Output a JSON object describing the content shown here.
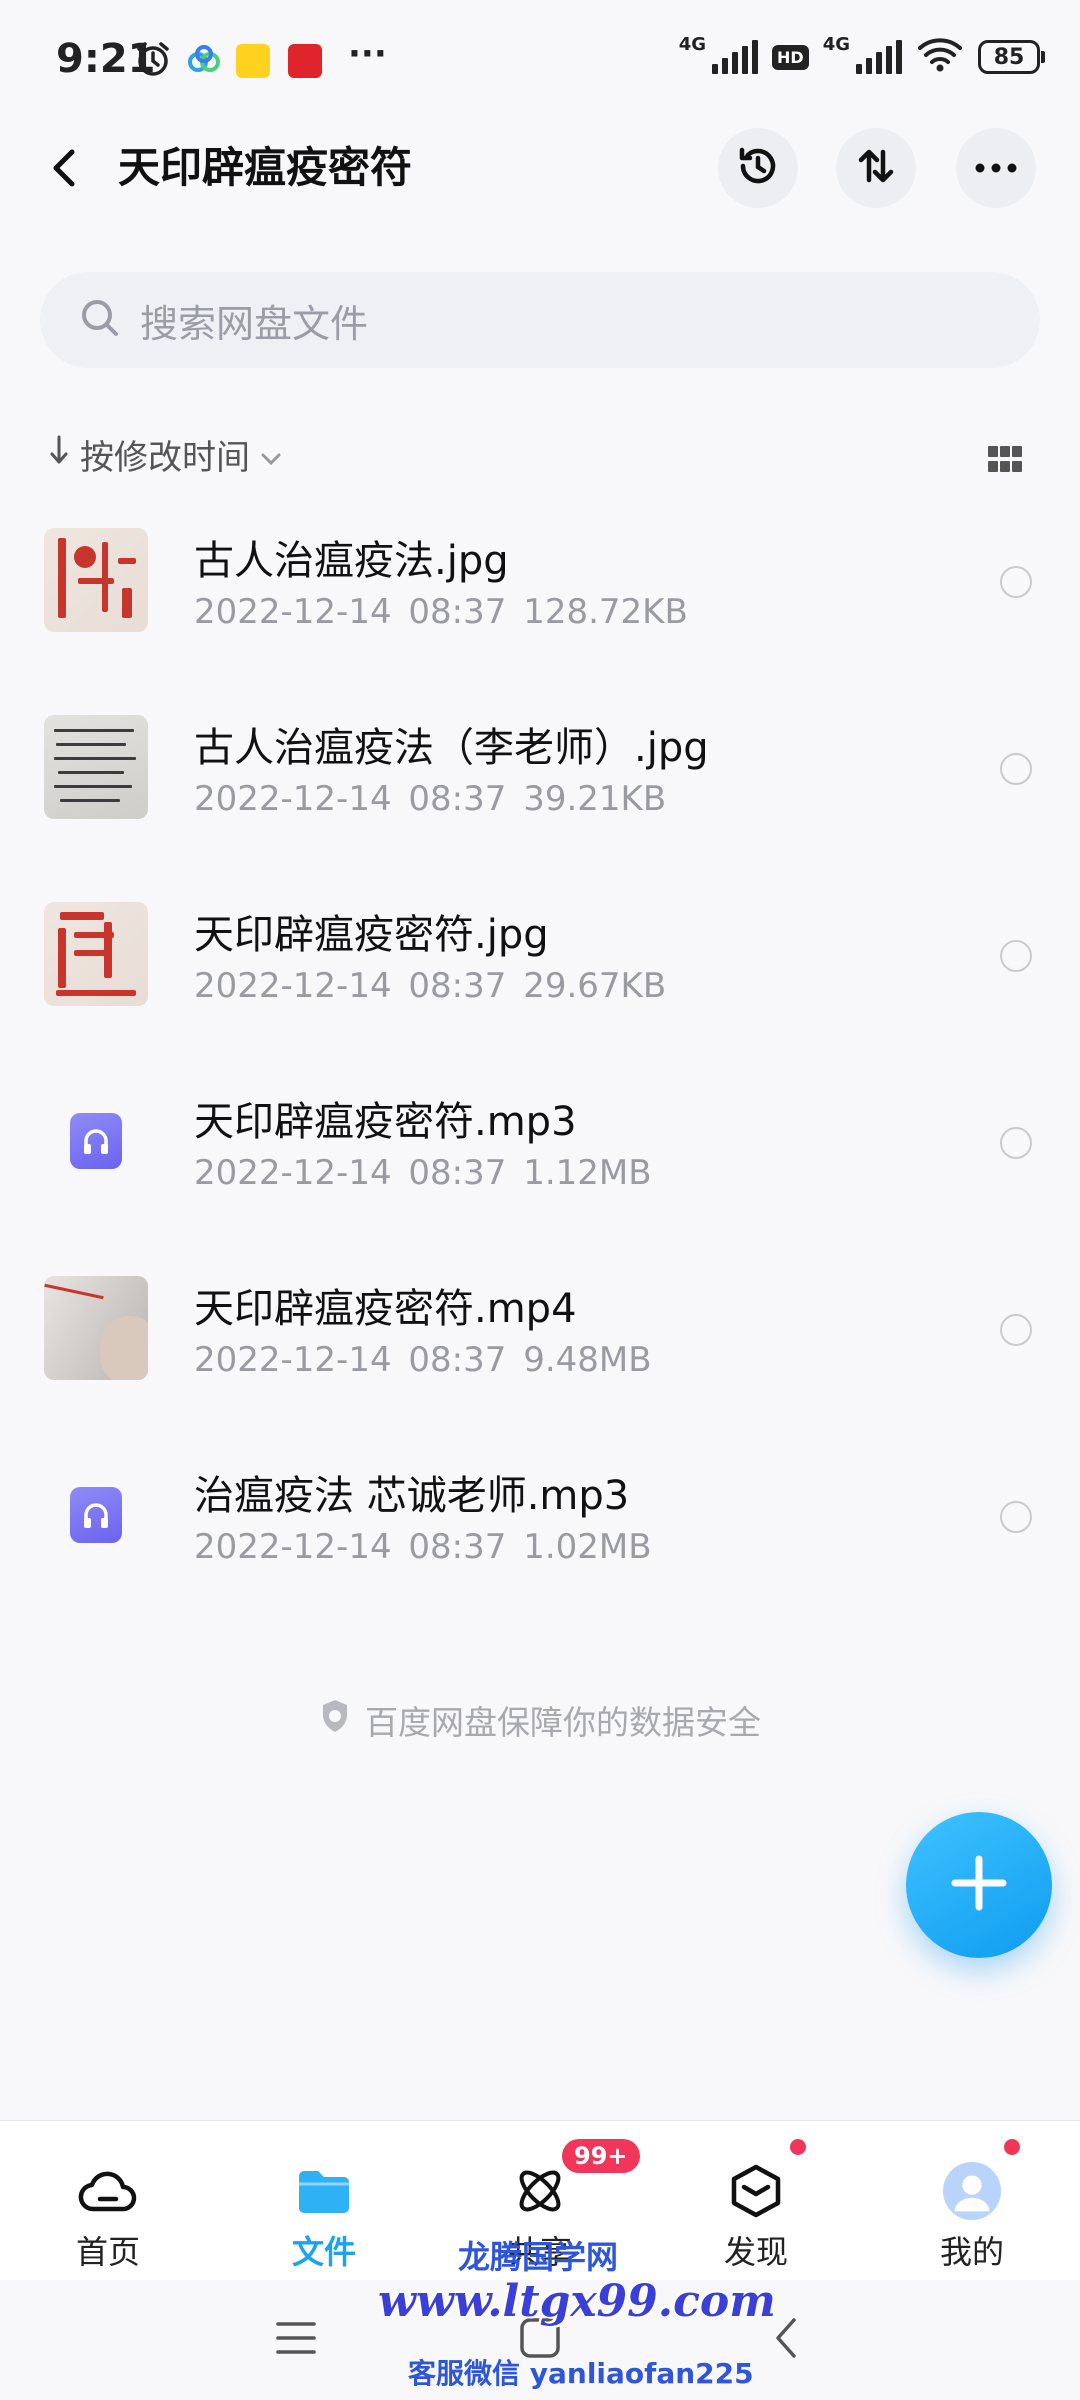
{
  "status_bar": {
    "time": "9:21",
    "network_1": "4G",
    "hd": "HD",
    "network_2": "4G",
    "battery": "85"
  },
  "header": {
    "title": "天印辟瘟疫密符",
    "icons": [
      "back-icon",
      "history-icon",
      "sort-transfer-icon",
      "more-icon"
    ]
  },
  "search": {
    "placeholder": "搜索网盘文件"
  },
  "sort": {
    "label": "按修改时间"
  },
  "files": [
    {
      "name": "古人治瘟疫法.jpg",
      "meta": "2022-12-14  08:37  128.72KB",
      "kind": "image"
    },
    {
      "name": "古人治瘟疫法（李老师）.jpg",
      "meta": "2022-12-14  08:37  39.21KB",
      "kind": "image"
    },
    {
      "name": "天印辟瘟疫密符.jpg",
      "meta": "2022-12-14  08:37  29.67KB",
      "kind": "image"
    },
    {
      "name": "天印辟瘟疫密符.mp3",
      "meta": "2022-12-14  08:37  1.12MB",
      "kind": "audio"
    },
    {
      "name": "天印辟瘟疫密符.mp4",
      "meta": "2022-12-14  08:37  9.48MB",
      "kind": "video"
    },
    {
      "name": "治瘟疫法 芯诚老师.mp3",
      "meta": "2022-12-14  08:37  1.02MB",
      "kind": "audio"
    }
  ],
  "footer_note": "百度网盘保障你的数据安全",
  "nav": {
    "tabs": [
      {
        "label": "首页",
        "icon": "cloud-icon"
      },
      {
        "label": "文件",
        "icon": "folder-icon",
        "active": true
      },
      {
        "label": "共享",
        "icon": "atom-icon",
        "badge": "99+"
      },
      {
        "label": "发现",
        "icon": "cube-icon"
      },
      {
        "label": "我的",
        "icon": "avatar-icon"
      }
    ]
  },
  "watermark": {
    "line1": "龙腾国学网",
    "line2": "www.ltgx99.com",
    "line3": "客服微信 yanliaofan225"
  },
  "colors": {
    "accent": "#1aa3f0",
    "badge": "#f2365a",
    "audio_icon": "#7a74f2"
  }
}
